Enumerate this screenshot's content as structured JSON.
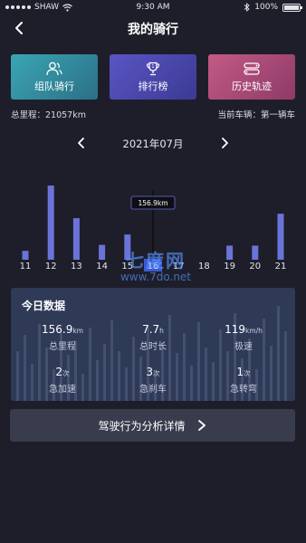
{
  "status_bar": {
    "carrier": "SHAW",
    "time": "9:30 AM",
    "battery": "100%",
    "icons": [
      "signal-icon",
      "wifi-icon",
      "bluetooth-icon",
      "battery-icon"
    ]
  },
  "nav": {
    "title": "我的骑行",
    "back_icon": "chevron-left-icon"
  },
  "tiles": [
    {
      "label": "组队骑行",
      "icon": "people-icon",
      "color": "#3aa6b4"
    },
    {
      "label": "排行榜",
      "icon": "trophy-icon",
      "color": "#5a55c4"
    },
    {
      "label": "历史轨迹",
      "icon": "route-icon",
      "color": "#c45a86"
    }
  ],
  "info": {
    "total_mileage": "总里程：21057km",
    "current_vehicle": "当前车辆：第一辆车"
  },
  "month_nav": {
    "label": "2021年07月",
    "prev_icon": "chevron-left-icon",
    "next_icon": "chevron-right-icon"
  },
  "chart_data": {
    "type": "bar",
    "categories": [
      "11",
      "12",
      "13",
      "14",
      "15",
      "16",
      "17",
      "18",
      "19",
      "20",
      "21"
    ],
    "values": [
      0.12,
      1.0,
      0.56,
      0.2,
      0.34,
      0,
      0,
      0,
      0.19,
      0.19,
      0.62
    ],
    "selected_category": "16",
    "selected_tooltip": "156.9km",
    "bar_color": "#6a74d8",
    "selected_color": "#ffffff"
  },
  "watermark": {
    "line1": "七度网",
    "line2": "www.7do.net"
  },
  "today": {
    "heading": "今日数据",
    "stats": [
      {
        "value": "156.9",
        "unit": "km",
        "label": "总里程"
      },
      {
        "value": "7.7",
        "unit": "h",
        "label": "总时长"
      },
      {
        "value": "119",
        "unit": "km/h",
        "label": "极速"
      },
      {
        "value": "2",
        "unit": "次",
        "label": "急加速"
      },
      {
        "value": "3",
        "unit": "次",
        "label": "急刹车"
      },
      {
        "value": "1",
        "unit": "次",
        "label": "急转弯"
      }
    ]
  },
  "analysis_button": {
    "label": "驾驶行为分析详情",
    "icon": "chevron-right-icon"
  }
}
